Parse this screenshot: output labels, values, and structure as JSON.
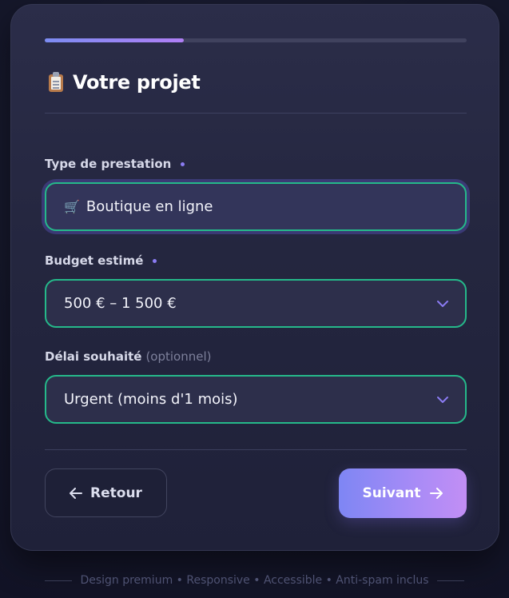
{
  "progress": {
    "percent": 33
  },
  "header": {
    "title_icon": "clipboard-icon",
    "title": "Votre projet"
  },
  "fields": {
    "service_type": {
      "label": "Type de prestation",
      "required": true,
      "icon": "shopping-cart-icon",
      "value": "Boutique en ligne"
    },
    "budget": {
      "label": "Budget estimé",
      "required": true,
      "value": "500 € – 1 500 €"
    },
    "deadline": {
      "label": "Délai souhaité",
      "optional_note": "(optionnel)",
      "value": "Urgent (moins d'1 mois)"
    }
  },
  "actions": {
    "back_label": "Retour",
    "next_label": "Suivant"
  },
  "footer": {
    "text": "Design premium • Responsive • Accessible • Anti-spam inclus"
  },
  "colors": {
    "accent": "#8b7cf3",
    "field_border": "#25b98a",
    "button_gradient_start": "#7e86f4",
    "button_gradient_end": "#c28ef5"
  }
}
